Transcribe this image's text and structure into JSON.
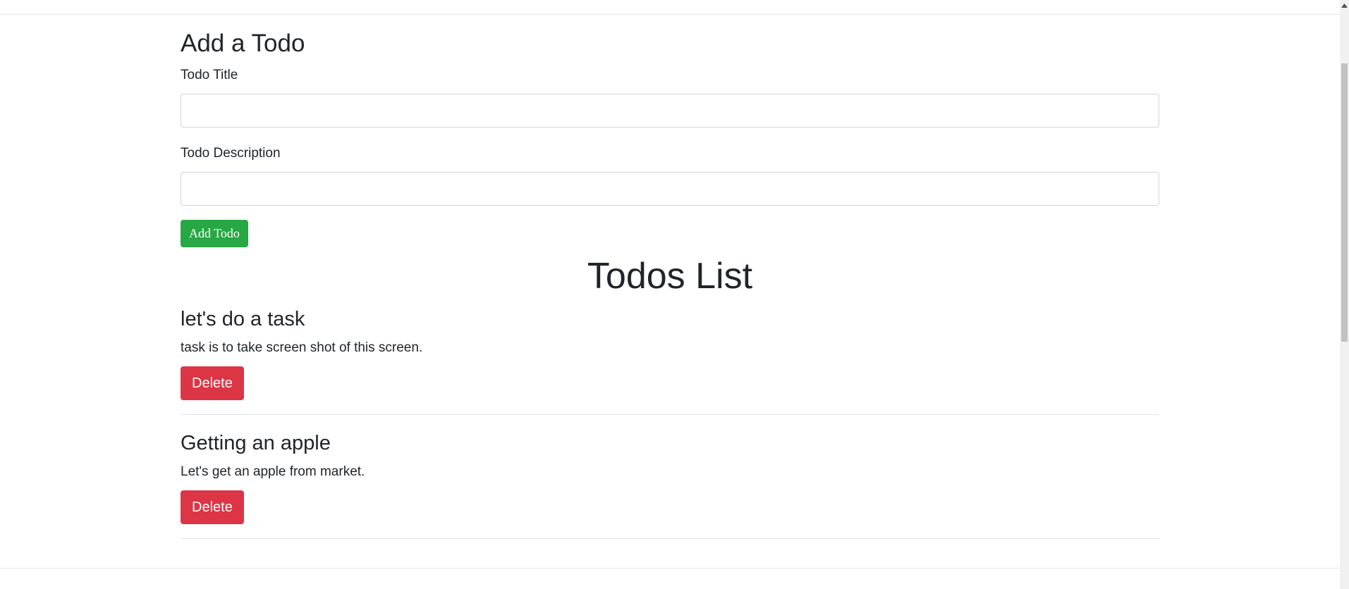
{
  "form": {
    "heading": "Add a Todo",
    "title_label": "Todo Title",
    "title_value": "",
    "description_label": "Todo Description",
    "description_value": "",
    "add_button_label": "Add Todo"
  },
  "list": {
    "heading": "Todos List",
    "items": [
      {
        "title": "let's do a task",
        "description": "task is to take screen shot of this screen.",
        "delete_label": "Delete"
      },
      {
        "title": "Getting an apple",
        "description": "Let's get an apple from market.",
        "delete_label": "Delete"
      }
    ]
  },
  "colors": {
    "add_button": "#28a745",
    "delete_button": "#dc3545",
    "text": "#212529"
  },
  "icons": {
    "scroll_up": "chevron-up-icon"
  }
}
